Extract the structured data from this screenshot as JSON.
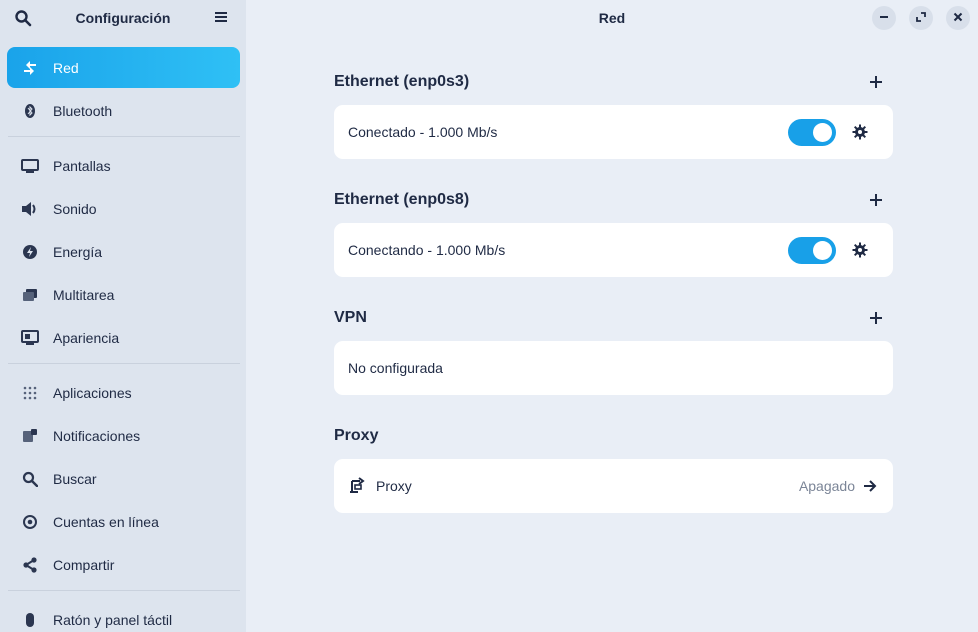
{
  "sidebar": {
    "title": "Configuración",
    "items": [
      {
        "label": "Red",
        "icon": "network-icon",
        "active": true
      },
      {
        "label": "Bluetooth",
        "icon": "bluetooth-icon"
      },
      {
        "label": "Pantallas",
        "icon": "display-icon"
      },
      {
        "label": "Sonido",
        "icon": "speaker-icon"
      },
      {
        "label": "Energía",
        "icon": "power-icon"
      },
      {
        "label": "Multitarea",
        "icon": "multitask-icon"
      },
      {
        "label": "Apariencia",
        "icon": "appearance-icon"
      },
      {
        "label": "Aplicaciones",
        "icon": "apps-grid-icon"
      },
      {
        "label": "Notificaciones",
        "icon": "notifications-icon"
      },
      {
        "label": "Buscar",
        "icon": "search-icon"
      },
      {
        "label": "Cuentas en línea",
        "icon": "online-accounts-icon"
      },
      {
        "label": "Compartir",
        "icon": "share-icon"
      },
      {
        "label": "Ratón y panel táctil",
        "icon": "mouse-icon"
      }
    ]
  },
  "main": {
    "title": "Red",
    "sections": [
      {
        "title": "Ethernet (enp0s3)",
        "row": "Conectado - 1.000 Mb/s",
        "toggle": true
      },
      {
        "title": "Ethernet (enp0s8)",
        "row": "Conectando - 1.000 Mb/s",
        "toggle": true
      },
      {
        "title": "VPN",
        "row": "No configurada"
      },
      {
        "title": "Proxy",
        "row": "Proxy",
        "status": "Apagado"
      }
    ]
  },
  "colors": {
    "accent": "#18a0e8",
    "sidebar_bg": "#dde4ee",
    "main_bg": "#e9eef6"
  }
}
